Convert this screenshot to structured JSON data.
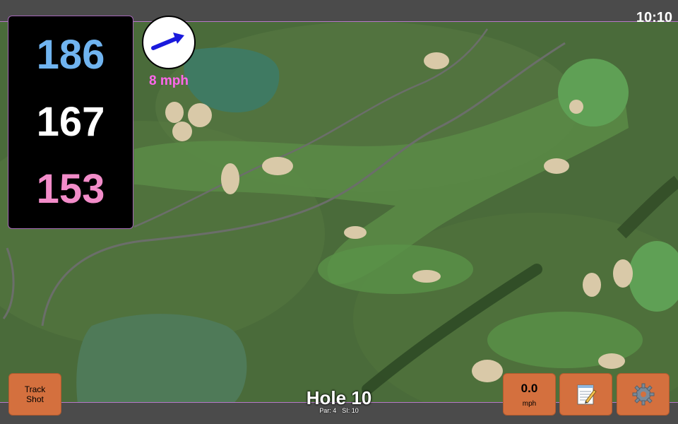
{
  "status": {
    "time": "10:10"
  },
  "distances": {
    "back": "186",
    "middle": "167",
    "front": "153"
  },
  "wind": {
    "speed": "8 mph",
    "icon": "arrow-icon",
    "color": "#1a1adc"
  },
  "hole": {
    "title": "Hole 10",
    "par": "Par: 4",
    "si": "SI: 10"
  },
  "buttons": {
    "track_shot": "Track Shot",
    "speed_value": "0.0",
    "speed_unit": "mph",
    "notes_icon": "notepad-icon",
    "settings_icon": "gear-icon"
  },
  "colors": {
    "button": "#d4703e",
    "back": "#70b4f0",
    "front": "#f28cc9",
    "wind_text": "#ff67ec"
  }
}
